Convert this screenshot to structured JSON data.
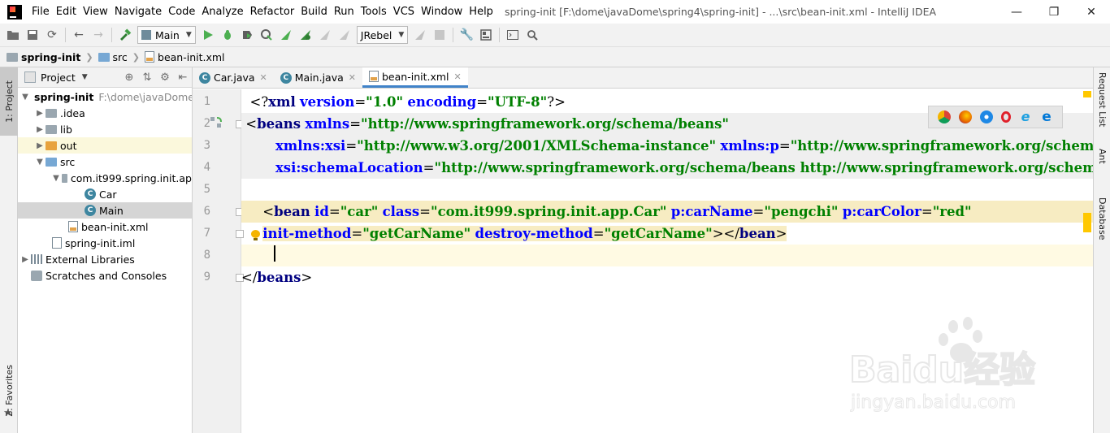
{
  "menubar": {
    "items": [
      "File",
      "Edit",
      "View",
      "Navigate",
      "Code",
      "Analyze",
      "Refactor",
      "Build",
      "Run",
      "Tools",
      "VCS",
      "Window",
      "Help"
    ],
    "title": "spring-init [F:\\dome\\javaDome\\spring4\\spring-init] - ...\\src\\bean-init.xml - IntelliJ IDEA"
  },
  "toolbar": {
    "run_config": "Main",
    "jrebel": "JRebel"
  },
  "navbar": {
    "crumbs": [
      "spring-init",
      "src",
      "bean-init.xml"
    ]
  },
  "left_strip": {
    "project_tab": "1: Project",
    "favorites_tab": "2: Favorites"
  },
  "project_panel": {
    "title": "Project",
    "tree": [
      {
        "label": "spring-init",
        "hint": "F:\\dome\\javaDome"
      },
      {
        "label": ".idea"
      },
      {
        "label": "lib"
      },
      {
        "label": "out"
      },
      {
        "label": "src"
      },
      {
        "label": "com.it999.spring.init.ap"
      },
      {
        "label": "Car"
      },
      {
        "label": "Main"
      },
      {
        "label": "bean-init.xml"
      },
      {
        "label": "spring-init.iml"
      },
      {
        "label": "External Libraries"
      },
      {
        "label": "Scratches and Consoles"
      }
    ]
  },
  "editor_tabs": [
    {
      "label": "Car.java"
    },
    {
      "label": "Main.java"
    },
    {
      "label": "bean-init.xml"
    }
  ],
  "editor": {
    "line_numbers": [
      "1",
      "2",
      "3",
      "4",
      "5",
      "6",
      "7",
      "8",
      "9"
    ]
  },
  "right_strip": {
    "tabs": [
      "Request List",
      "Ant",
      "Database"
    ]
  },
  "watermark": {
    "brand": "Baidu经验",
    "url": "jingyan.baidu.com"
  },
  "colors": {
    "tag": "#000080",
    "attr": "#0000ff",
    "string": "#008000",
    "active_tab_underline": "#4083c9",
    "current_line": "#fffae3",
    "highlight": "#f7ecc2"
  }
}
